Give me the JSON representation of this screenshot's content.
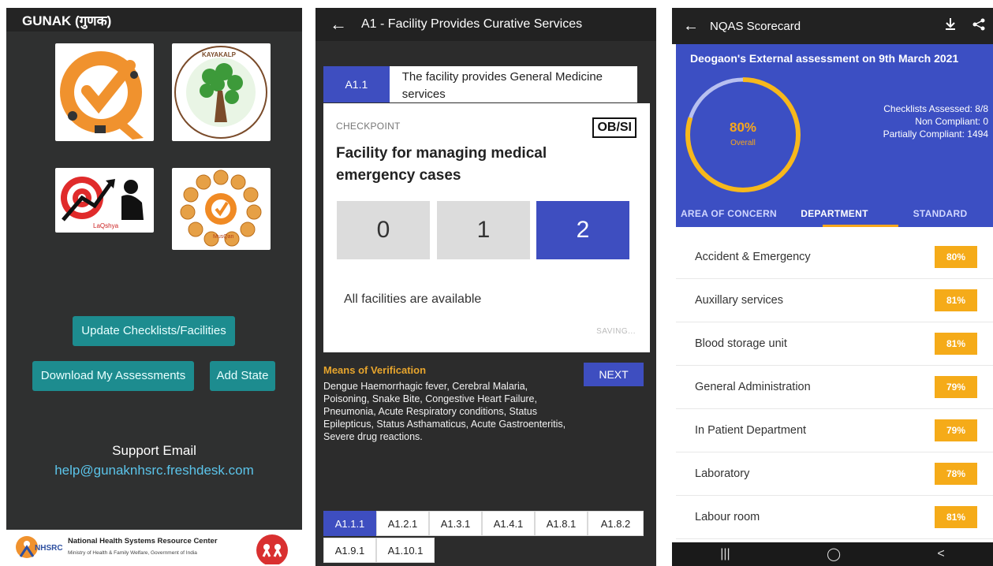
{
  "screen1": {
    "title": "GUNAK (गुणक)",
    "logos": {
      "kayakalp_text": "KAYAKALP",
      "lakshya_text": "LaQshya",
      "mera_text": "MusQan"
    },
    "buttons": {
      "update": "Update Checklists/Facilities",
      "download": "Download My Assessments",
      "add_state": "Add State"
    },
    "support_title": "Support Email",
    "support_email": "help@gunaknhsrc.freshdesk.com",
    "footer": {
      "org": "National Health Systems Resource Center",
      "ministry": "Ministry of Health & Family Welfare, Government of India",
      "logo_text": "NHSRC"
    }
  },
  "screen2": {
    "title": "A1 - Facility Provides Curative Services",
    "criterion": {
      "code": "A1.1",
      "text": "The facility provides General Medicine services"
    },
    "checkpoint_label": "CHECKPOINT",
    "method": "OB/SI",
    "checkpoint_title": "Facility for managing medical emergency cases",
    "scores": [
      "0",
      "1",
      "2"
    ],
    "selected_score": "2",
    "compliance_note": "All facilities are available",
    "saving": "SAVING...",
    "means_heading": "Means of Verification",
    "means_text": "Dengue Haemorrhagic fever, Cerebral Malaria, Poisoning, Snake Bite, Congestive Heart Failure, Pneumonia, Acute Respiratory conditions, Status Epilepticus, Status Asthamaticus, Acute Gastroenteritis, Severe drug reactions.",
    "next": "NEXT",
    "chips": [
      "A1.1.1",
      "A1.2.1",
      "A1.3.1",
      "A1.4.1",
      "A1.8.1",
      "A1.8.2",
      "A1.9.1",
      "A1.10.1"
    ],
    "selected_chip": "A1.1.1"
  },
  "screen3": {
    "title": "NQAS Scorecard",
    "assessment": "Deogaon's External assessment on 9th March 2021",
    "overall_value": "80%",
    "overall_label": "Overall",
    "overall_fraction": 0.8,
    "stats": {
      "checklists": "Checklists Assessed: 8/8",
      "non_compliant": "Non Compliant: 0",
      "partial": "Partially Compliant: 1494"
    },
    "tabs": [
      "AREA OF CONCERN",
      "DEPARTMENT",
      "STANDARD"
    ],
    "active_tab": "DEPARTMENT",
    "departments": [
      {
        "name": "Accident & Emergency",
        "score": "80%"
      },
      {
        "name": "Auxillary services",
        "score": "81%"
      },
      {
        "name": "Blood storage unit",
        "score": "81%"
      },
      {
        "name": "General Administration",
        "score": "79%"
      },
      {
        "name": "In Patient Department",
        "score": "79%"
      },
      {
        "name": "Laboratory",
        "score": "78%"
      },
      {
        "name": "Labour room",
        "score": "81%"
      }
    ],
    "nav": [
      "|||",
      "◯",
      "<"
    ]
  },
  "colors": {
    "primary_blue": "#3c4fc3",
    "teal": "#1d8c8f",
    "orange": "#f5ab19",
    "dark_bg": "#2f3030"
  }
}
